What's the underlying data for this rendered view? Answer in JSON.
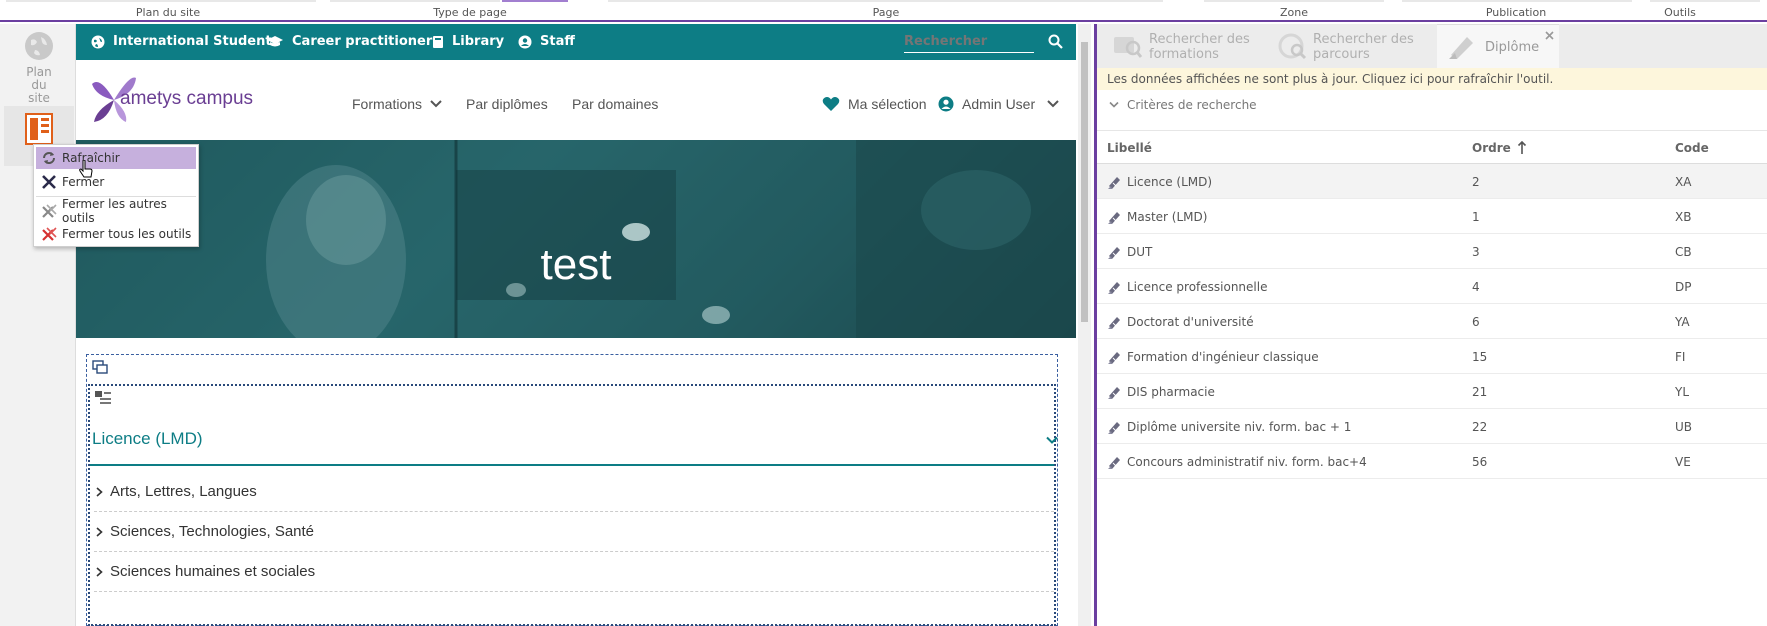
{
  "ribbon": {
    "groups": [
      "Plan du site",
      "Type de page",
      "Page",
      "Zone",
      "Publication",
      "Outils"
    ]
  },
  "left_tools": {
    "sitemap_label": "Plan du site"
  },
  "context_menu": {
    "items": [
      "Rafraîchir",
      "Fermer",
      "Fermer les autres outils",
      "Fermer tous les outils"
    ]
  },
  "site": {
    "topbar_links": [
      "International Students",
      "Career practitioners",
      "Library",
      "Staff"
    ],
    "search_placeholder": "Rechercher",
    "logo": "ametys campus",
    "nav": [
      "Formations",
      "Par diplômes",
      "Par domaines"
    ],
    "selection": "Ma sélection",
    "user": "Admin User",
    "hero_title": "test",
    "accordion_title": "Licence (LMD)",
    "categories": [
      "Arts, Lettres, Langues",
      "Sciences, Technologies, Santé",
      "Sciences humaines et sociales"
    ]
  },
  "panel": {
    "tabs": [
      "Rechercher des formations",
      "Rechercher des parcours",
      "Diplôme"
    ],
    "notice": "Les données affichées ne sont plus à jour. Cliquez ici pour rafraîchir l'outil.",
    "criteria": "Critères de recherche",
    "columns": [
      "Libellé",
      "Ordre",
      "Code"
    ],
    "rows": [
      {
        "label": "Licence (LMD)",
        "order": "2",
        "code": "XA"
      },
      {
        "label": "Master (LMD)",
        "order": "1",
        "code": "XB"
      },
      {
        "label": "DUT",
        "order": "3",
        "code": "CB"
      },
      {
        "label": "Licence professionnelle",
        "order": "4",
        "code": "DP"
      },
      {
        "label": "Doctorat d'université",
        "order": "6",
        "code": "YA"
      },
      {
        "label": "Formation d'ingénieur classique",
        "order": "15",
        "code": "FI"
      },
      {
        "label": "DIS pharmacie",
        "order": "21",
        "code": "YL"
      },
      {
        "label": "Diplôme universite niv. form. bac + 1",
        "order": "22",
        "code": "UB"
      },
      {
        "label": "Concours administratif niv. form. bac+4",
        "order": "56",
        "code": "VE"
      }
    ]
  },
  "colors": {
    "accent": "#6b3fa0",
    "teal": "#0d7d85",
    "notice_bg": "#fdf6dc",
    "menu_highlight": "#c6b0dd"
  }
}
